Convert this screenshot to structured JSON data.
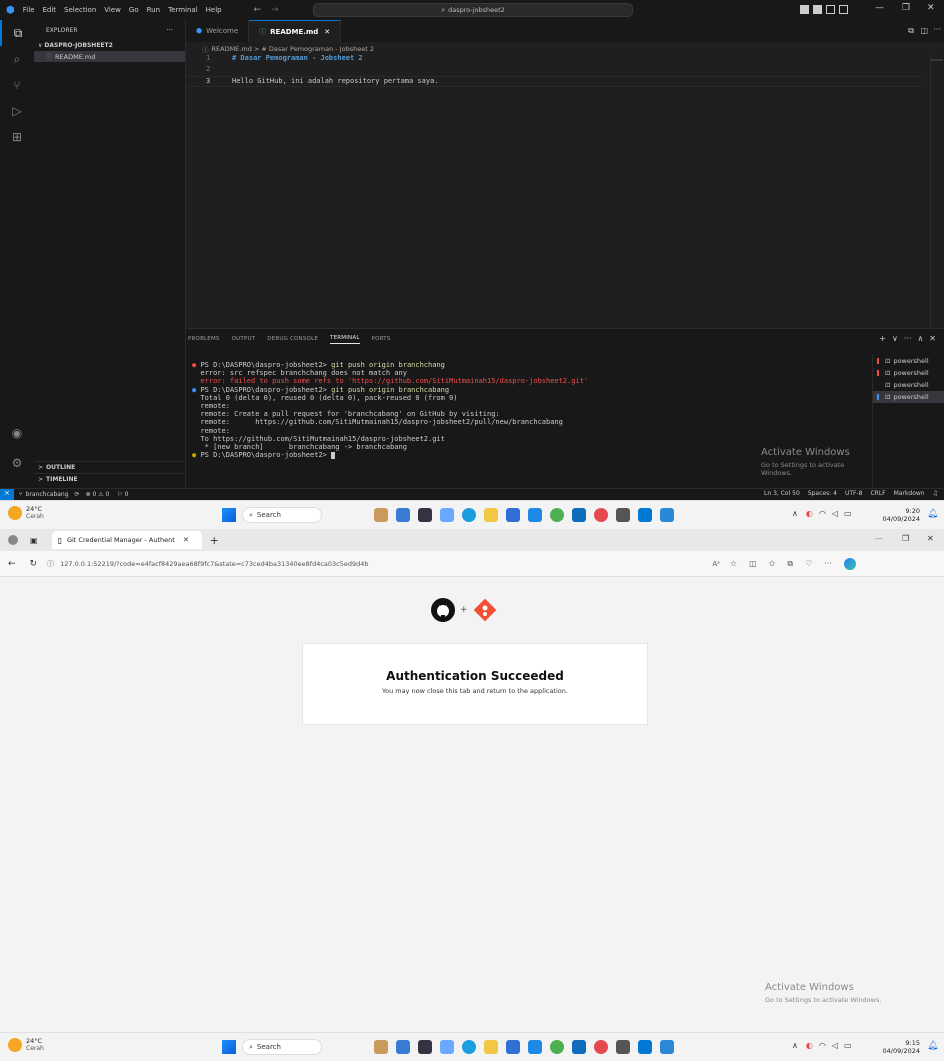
{
  "vscode": {
    "menu": [
      "File",
      "Edit",
      "Selection",
      "View",
      "Go",
      "Run",
      "Terminal",
      "Help"
    ],
    "search": "daspro-jobsheet2",
    "explorer_label": "EXPLORER",
    "folder": "DASPRO-JOBSHEET2",
    "file": "README.md",
    "outline": "OUTLINE",
    "timeline": "TIMELINE",
    "tabs": [
      {
        "label": "Welcome"
      },
      {
        "label": "README.md"
      }
    ],
    "close_glyph": "✕",
    "breadcrumb": "README.md > # Dasar Pemograman - Jobsheet 2",
    "editor_lines": [
      {
        "num": "1",
        "text": "# Dasar Pemograman - Jobsheet 2"
      },
      {
        "num": "2",
        "text": ""
      },
      {
        "num": "3",
        "text": "Hello GitHub, ini adalah repository pertama saya."
      }
    ],
    "panel_tabs": [
      "PROBLEMS",
      "OUTPUT",
      "DEBUG CONSOLE",
      "TERMINAL",
      "PORTS"
    ],
    "terminal_lines": [
      {
        "prompt": "PS D:\\DASPRO\\daspro-jobsheet2>",
        "cmd": " git push origin branchchang",
        "dot": "#f14c4c"
      },
      {
        "text": "  error: src refspec branchchang does not match any"
      },
      {
        "text": "  error: failed to push some refs to 'https://github.com/SitiMutmainah15/daspro-jobsheet2.git'",
        "color": "#f14c4c"
      },
      {
        "prompt": "PS D:\\DASPRO\\daspro-jobsheet2>",
        "cmd": " git push origin branchcabang",
        "dot": "#3794ff"
      },
      {
        "text": "  Total 0 (delta 0), reused 0 (delta 0), pack-reused 0 (from 0)"
      },
      {
        "text": "  remote:"
      },
      {
        "text": "  remote: Create a pull request for 'branchcabang' on GitHub by visiting:"
      },
      {
        "text": "  remote:      https://github.com/SitiMutmainah15/daspro-jobsheet2/pull/new/branchcabang"
      },
      {
        "text": "  remote:"
      },
      {
        "text": "  To https://github.com/SitiMutmainah15/daspro-jobsheet2.git"
      },
      {
        "text": "   * [new branch]      branchcabang -> branchcabang"
      },
      {
        "prompt": "PS D:\\DASPRO\\daspro-jobsheet2>",
        "cmd": " ",
        "dot": "#cca700"
      }
    ],
    "shells": [
      "powershell",
      "powershell",
      "powershell",
      "powershell"
    ],
    "status_left": [
      "branchcabang",
      "⊗ 0 ⚠ 0",
      "⚐ 0"
    ],
    "status_right": [
      "Ln 3, Col 50",
      "Spaces: 4",
      "UTF-8",
      "CRLF",
      "Markdown"
    ],
    "watermark_title": "Activate Windows",
    "watermark_sub": "Go to Settings to activate Windows."
  },
  "taskbar_top": {
    "temp": "24°C",
    "weather": "Cerah",
    "search": "Search",
    "time": "9:20",
    "date": "04/09/2024"
  },
  "taskbar_bottom": {
    "temp": "24°C",
    "weather": "Cerah",
    "search": "Search",
    "time": "9:15",
    "date": "04/09/2024"
  },
  "browser": {
    "tab_title": "Git Credential Manager - Authent",
    "url": "127.0.0.1:52219/?code=e4facf8429aea68f9fc7&state=c73ced4ba31340ee8fd4ca03c5ed9d4b",
    "plus": "+",
    "card_title": "Authentication Succeeded",
    "card_text": "You may now close this tab and return to the application.",
    "watermark_title": "Activate Windows",
    "watermark_sub": "Go to Settings to activate Windows."
  },
  "colors": {
    "accent": "#0078d4",
    "yellow": "#dcdcaa",
    "keyword": "#569cd6"
  }
}
